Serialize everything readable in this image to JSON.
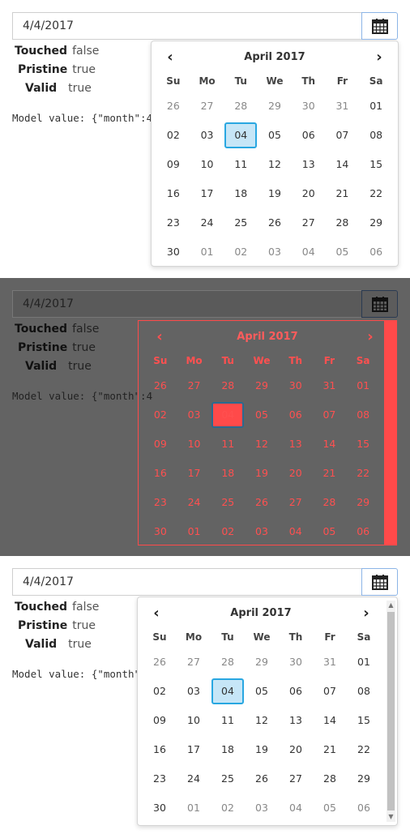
{
  "input": {
    "value": "4/4/2017"
  },
  "state": [
    {
      "label": "Touched",
      "value": "false"
    },
    {
      "label": "Pristine",
      "value": "true"
    },
    {
      "label": "Valid",
      "value": "true"
    }
  ],
  "model": {
    "full": "Model value: {\"month\":4",
    "short": "Model value: {\"month\""
  },
  "calendar": {
    "title": "April 2017",
    "prev": "‹",
    "next": "›",
    "dow": [
      "Su",
      "Mo",
      "Tu",
      "We",
      "Th",
      "Fr",
      "Sa"
    ],
    "weeks": [
      [
        "26",
        "27",
        "28",
        "29",
        "30",
        "31",
        "01"
      ],
      [
        "02",
        "03",
        "04",
        "05",
        "06",
        "07",
        "08"
      ],
      [
        "09",
        "10",
        "11",
        "12",
        "13",
        "14",
        "15"
      ],
      [
        "16",
        "17",
        "18",
        "19",
        "20",
        "21",
        "22"
      ],
      [
        "23",
        "24",
        "25",
        "26",
        "27",
        "28",
        "29"
      ],
      [
        "30",
        "01",
        "02",
        "03",
        "04",
        "05",
        "06"
      ]
    ],
    "selected": "04"
  },
  "icons": {
    "calendar": "calendar-icon",
    "prev": "chevron-left-icon",
    "next": "chevron-right-icon"
  },
  "colors": {
    "selected_bg": "#c6e6f7",
    "selected_border": "#29a7e1",
    "debug": "#ff4a4a",
    "overlay": "#636363"
  }
}
